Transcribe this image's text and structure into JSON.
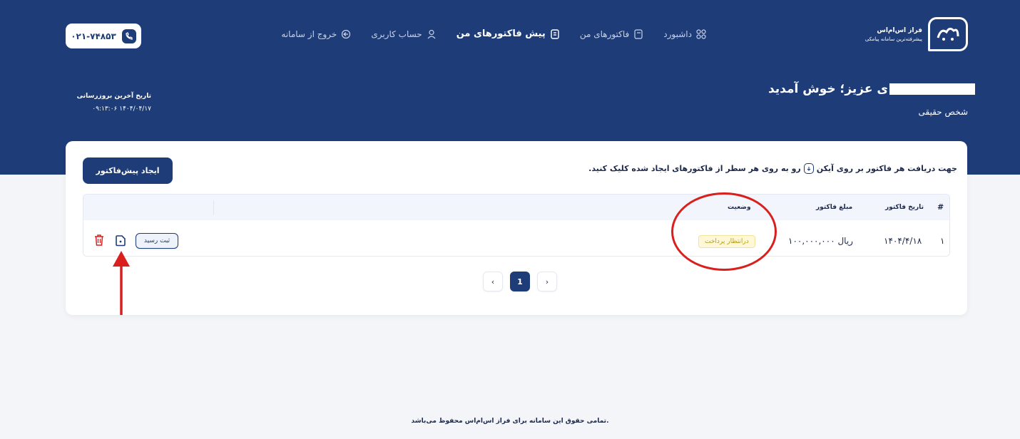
{
  "brand": {
    "name": "فراز اس‌ام‌اس",
    "tagline": "پیشرفته‌ترین سامانه پیامکی"
  },
  "nav": [
    {
      "label": "داشبورد",
      "icon": "grid-icon",
      "active": false
    },
    {
      "label": "فاکتورهای من",
      "icon": "invoice-icon",
      "active": false
    },
    {
      "label": "پیش فاکتورهای من",
      "icon": "receipt-icon",
      "active": true
    },
    {
      "label": "حساب کاربری",
      "icon": "user-icon",
      "active": false
    },
    {
      "label": "خروج از سامانه",
      "icon": "logout-icon",
      "active": false
    }
  ],
  "phone": {
    "number": "۰۲۱-۷۴۸۵۳",
    "icon": "phone-icon"
  },
  "welcome": {
    "text": "ی عزیز؛ خوش آمدید",
    "user_type": "شخص حقیقی"
  },
  "last_update": {
    "label": "تاریخ آخرین بروزرسانی",
    "value": "۱۴۰۴/۰۴/۱۷ ۰۹:۱۳:۰۶"
  },
  "hint": {
    "before": "جهت دریافت هر فاکتور بر روی آیکن",
    "after": "رو به روی هر سطر از فاکتورهای ایجاد شده کلیک کنید."
  },
  "create_button": "ایجاد پیش‌فاکتور",
  "table": {
    "headers": {
      "index": "#",
      "date": "تاریخ فاکتور",
      "amount": "مبلغ فاکتور",
      "status": "وضعیت"
    },
    "rows": [
      {
        "index": "۱",
        "date": "۱۴۰۴/۴/۱۸",
        "amount": "۱۰۰,۰۰۰,۰۰۰ ریال",
        "status": "درانتظار پرداخت",
        "receipt_label": "ثبت رسید"
      }
    ]
  },
  "pagination": {
    "prev": "‹",
    "current": "1",
    "next": "›"
  },
  "footer": "تمامی حقوق این سامانه برای فراز اس‌ام‌اس محفوظ می‌باشد.",
  "colors": {
    "primary": "#1e3c78",
    "annotation": "#d9201f",
    "status_badge_bg": "#fff8d8"
  }
}
